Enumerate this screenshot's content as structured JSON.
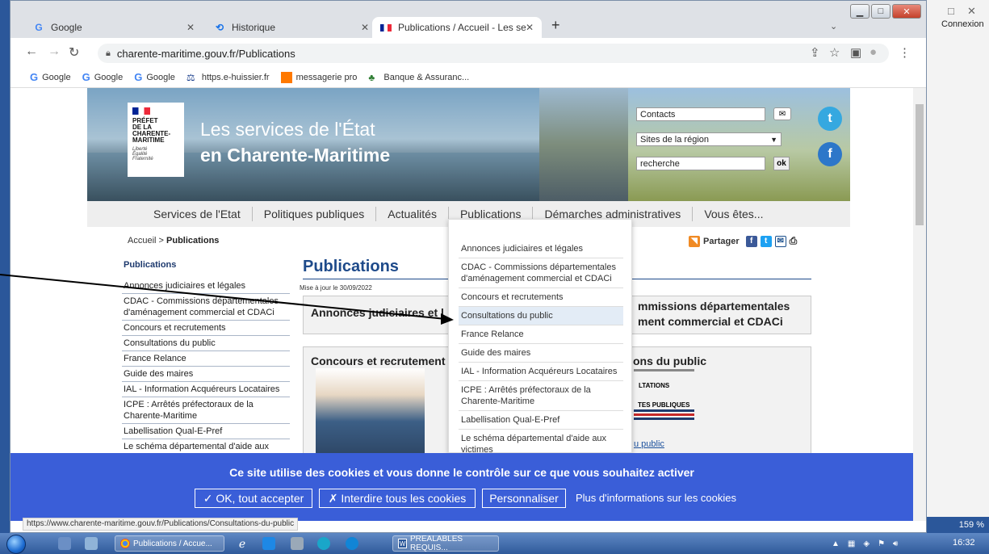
{
  "background_app": {
    "connexion": "Connexion",
    "zoom": "159 %",
    "window_controls": [
      "□",
      "✕"
    ]
  },
  "tabs": [
    {
      "label": "Google",
      "icon": "google-icon",
      "close": "✕"
    },
    {
      "label": "Historique",
      "icon": "history-icon",
      "close": "✕"
    },
    {
      "label": "Publications / Accueil - Les servic",
      "icon": "flag-icon",
      "close": "✕"
    }
  ],
  "new_tab": "+",
  "tab_menu": "⌄",
  "address": {
    "url": "charente-maritime.gouv.fr/Publications"
  },
  "bookmarks": [
    {
      "label": "Google",
      "icon": "google-icon"
    },
    {
      "label": "Google",
      "icon": "google-icon"
    },
    {
      "label": "Google",
      "icon": "google-icon"
    },
    {
      "label": "https.e-huissier.fr",
      "icon": "huissier-icon"
    },
    {
      "label": "messagerie pro",
      "icon": "mail-icon"
    },
    {
      "label": "Banque & Assuranc...",
      "icon": "bank-icon"
    }
  ],
  "site": {
    "logo": {
      "text": "PRÉFET\nDE LA\nCHARENTE-\nMARITIME",
      "motto": "Liberté\nÉgalité\nFraternité"
    },
    "title_line1": "Les services de l'État",
    "title_line2": "en Charente-Maritime",
    "header": {
      "contacts": "Contacts",
      "sites": "Sites de la région",
      "search_placeholder": "recherche",
      "ok": "ok"
    },
    "nav": [
      "Services de l'Etat",
      "Politiques publiques",
      "Actualités",
      "Publications",
      "Démarches administratives",
      "Vous êtes..."
    ],
    "breadcrumb_home": "Accueil",
    "breadcrumb_sep": " > ",
    "breadcrumb_current": "Publications",
    "share": "Partager",
    "left_title": "Publications",
    "left_items": [
      "Annonces judiciaires et légales",
      "CDAC - Commissions départementales d'aménagement commercial et CDACi",
      "Concours et recrutements",
      "Consultations du public",
      "France Relance",
      "Guide des maires",
      "IAL - Information Acquéreurs Locataires",
      "ICPE : Arrêtés préfectoraux de la Charente-Maritime",
      "Labellisation Qual-E-Pref",
      "Le schéma départemental d'aide aux"
    ],
    "page_title": "Publications",
    "updated": "Mise à jour le 30/09/2022",
    "box1_title": "Annonces judiciaires et l",
    "box2_title_line1": "mmissions départementales",
    "box2_title_line2": "ment commercial et CDACi",
    "box3_title": "Concours et recrutement",
    "box4_title": "ons du public",
    "box4_small1": "LTATIONS",
    "box4_small2": "TES PUBLIQUES",
    "box4_link": "u public",
    "dropdown": [
      "Annonces judiciaires et légales",
      "CDAC - Commissions départementales d'aménagement commercial et CDACi",
      "Concours et recrutements",
      "Consultations du public",
      "France Relance",
      "Guide des maires",
      "IAL - Information Acquéreurs Locataires",
      "ICPE : Arrêtés préfectoraux de la Charente-Maritime",
      "Labellisation Qual-E-Pref",
      "Le schéma départemental d'aide aux victimes"
    ]
  },
  "cookie": {
    "message": "Ce site utilise des cookies et vous donne le contrôle sur ce que vous souhaitez activer",
    "accept": "✓ OK, tout accepter",
    "deny": "✗ Interdire tous les cookies",
    "customize": "Personnaliser",
    "more": "Plus d'informations sur les cookies"
  },
  "status_url": "https://www.charente-maritime.gouv.fr/Publications/Consultations-du-public",
  "taskbar": {
    "chrome_app": "Publications / Accue...",
    "word_app": "PREALABLES REQUIS...",
    "clock": "16:32"
  }
}
